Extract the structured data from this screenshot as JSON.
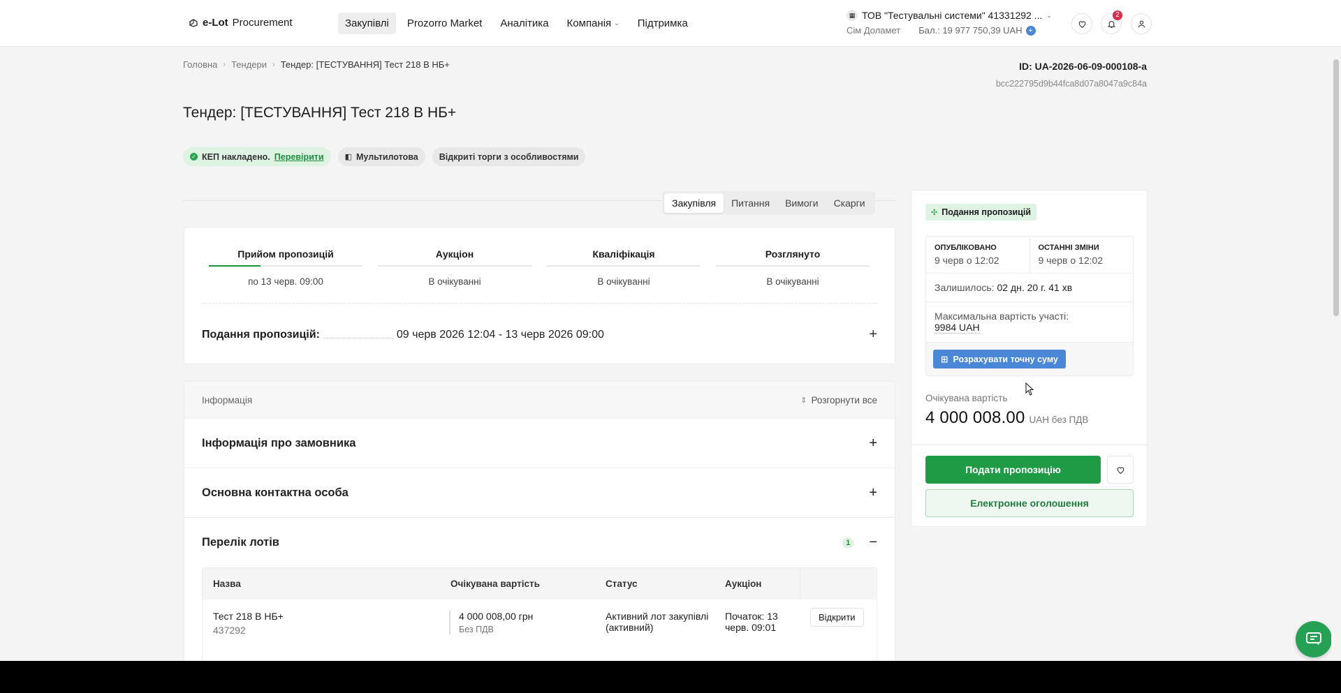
{
  "header": {
    "logo_bold": "e-Lot",
    "logo_rest": "Procurement",
    "nav": [
      {
        "label": "Закупівлі",
        "active": true
      },
      {
        "label": "Prozorro Market"
      },
      {
        "label": "Аналітика"
      },
      {
        "label": "Компанія",
        "dropdown": true
      },
      {
        "label": "Підтримка"
      }
    ],
    "company_name": "ТОВ \"Тестувальні системи\" 41331292 ...",
    "user_name": "Сім Доламет",
    "balance": "Бал.: 19 977 750,39 UAH",
    "notifications_count": "2"
  },
  "breadcrumb": {
    "home": "Головна",
    "tenders": "Тендери",
    "current": "Тендер: [ТЕСТУВАННЯ] Тест 218 В НБ+"
  },
  "tender": {
    "id": "ID: UA-2026-06-09-000108-a",
    "hash": "bcc222795d9b44fca8d07a8047a9c84a",
    "title": "Тендер: [ТЕСТУВАННЯ] Тест 218 В НБ+",
    "tags": {
      "kep": "КЕП накладено.",
      "kep_link": "Перевірити",
      "multilot": "Мультилотова",
      "procedure": "Відкриті торги з особливостями"
    }
  },
  "tabs": [
    "Закупівля",
    "Питання",
    "Вимоги",
    "Скарги"
  ],
  "stages": [
    {
      "title": "Прийом пропозицій",
      "sub": "по 13 черв. 09:00"
    },
    {
      "title": "Аукціон",
      "sub": "В очікуванні"
    },
    {
      "title": "Кваліфікація",
      "sub": "В очікуванні"
    },
    {
      "title": "Розглянуто",
      "sub": "В очікуванні"
    }
  ],
  "submission": {
    "label": "Подання пропозицій:",
    "period": "09 черв 2026 12:04 - 13 черв 2026 09:00"
  },
  "info": {
    "head": "Інформація",
    "expand_all": "Розгорнути все",
    "customer": "Інформація про замовника",
    "contact": "Основна контактна особа",
    "lots": "Перелік лотів",
    "lots_count": "1",
    "table_headers": [
      "Назва",
      "Очікувана вартість",
      "Статус",
      "Аукціон"
    ],
    "lot": {
      "name": "Тест 218 В НБ+",
      "code": "437292",
      "price": "4 000 008,00 грн",
      "vat": "Без ПДВ",
      "status": "Активний лот закупівлі (активний)",
      "auction": "Початок: 13 черв. 09:01",
      "open": "Відкрити"
    }
  },
  "sidebar": {
    "status": "Подання пропозицій",
    "published_label": "ОПУБЛІКОВАНО",
    "published_value": "9 черв о 12:02",
    "changed_label": "ОСТАННІ ЗМІНИ",
    "changed_value": "9 черв о 12:02",
    "remaining_label": "Залишилось:",
    "remaining_value": "02 дн. 20 г. 41 хв",
    "max_cost_label": "Максимальна вартість участі:",
    "max_cost_value": "9984 UAH",
    "calc_btn": "Розрахувати точну суму",
    "expected_label": "Очікувана вартість",
    "expected_value": "4 000 008.00",
    "expected_currency": "UAH без ПДВ",
    "submit_btn": "Подати пропозицію",
    "notice_btn": "Електронне оголошення"
  },
  "colors": {
    "brand_green": "#1f9b45",
    "accent_blue": "#4a87d6",
    "badge_red": "#d92d4d"
  }
}
